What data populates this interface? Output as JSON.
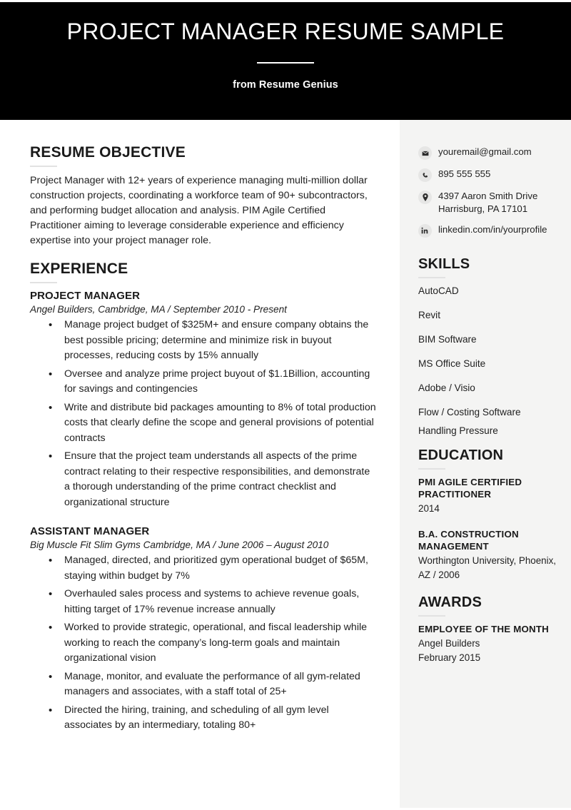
{
  "header": {
    "title": "PROJECT MANAGER RESUME SAMPLE",
    "subtitle": "from Resume Genius"
  },
  "objective": {
    "heading": "RESUME OBJECTIVE",
    "text": "Project Manager with 12+ years of experience managing multi-million dollar construction projects, coordinating a workforce team of 90+ subcontractors, and performing budget allocation and analysis. PIM Agile Certified Practitioner aiming to leverage considerable experience and efficiency expertise into your project manager role."
  },
  "experience": {
    "heading": "EXPERIENCE",
    "jobs": [
      {
        "title": "PROJECT MANAGER",
        "meta": "Angel Builders, Cambridge, MA  /  September 2010 - Present",
        "bullets": [
          "Manage project budget of $325M+ and ensure company obtains the best possible pricing; determine and minimize risk in buyout processes, reducing costs by 15% annually",
          "Oversee and analyze prime project buyout of $1.1Billion, accounting for savings and contingencies",
          "Write and distribute bid packages amounting to 8% of total production costs that clearly define the scope and general provisions of potential contracts",
          "Ensure that the project team understands all aspects of the prime contract relating to their respective responsibilities, and demonstrate a thorough understanding of the prime contract checklist and organizational structure"
        ]
      },
      {
        "title": "ASSISTANT MANAGER",
        "meta": "Big Muscle Fit Slim Gyms Cambridge, MA  /  June 2006 – August 2010",
        "bullets": [
          "Managed, directed, and prioritized gym operational budget of $65M, staying within budget by 7%",
          "Overhauled sales process and systems to achieve revenue goals, hitting target of 17% revenue increase annually",
          "Worked to provide strategic, operational, and fiscal leadership while working to reach the company’s long-term goals and maintain organizational vision",
          "Manage, monitor, and evaluate the performance of all gym-related managers and associates, with a staff total of 25+",
          "Directed the hiring, training, and scheduling of all gym level associates by an intermediary, totaling 80+"
        ]
      }
    ]
  },
  "sidebar": {
    "contact": [
      {
        "icon": "envelope-icon",
        "text": "youremail@gmail.com"
      },
      {
        "icon": "phone-icon",
        "text": "895 555 555"
      },
      {
        "icon": "map-pin-icon",
        "text": "4397 Aaron Smith Drive Harrisburg, PA 17101"
      },
      {
        "icon": "linkedin-icon",
        "text": "linkedin.com/in/yourprofile"
      }
    ],
    "address_line1": "4397 Aaron Smith Drive",
    "address_line2": "Harrisburg, PA 17101",
    "skills": {
      "heading": "SKILLS",
      "items": [
        "AutoCAD",
        "Revit",
        "BIM Software",
        "MS Office Suite",
        "Adobe / Visio",
        "Flow / Costing Software",
        "Handling Pressure"
      ]
    },
    "education": {
      "heading": "EDUCATION",
      "entries": [
        {
          "title": "PMI AGILE CERTIFIED PRACTITIONER",
          "sub": "2014"
        },
        {
          "title": "B.A. CONSTRUCTION MANAGEMENT",
          "sub": "Worthington University, Phoenix, AZ  /  2006"
        }
      ]
    },
    "awards": {
      "heading": "AWARDS",
      "entries": [
        {
          "title": "EMPLOYEE OF THE MONTH",
          "sub1": "Angel Builders",
          "sub2": "February 2015"
        }
      ]
    }
  },
  "colors": {
    "header_bg": "#000000",
    "sidebar_bg": "#f4f4f3",
    "text": "#1a1a1a",
    "rule": "#e2e2e2"
  }
}
